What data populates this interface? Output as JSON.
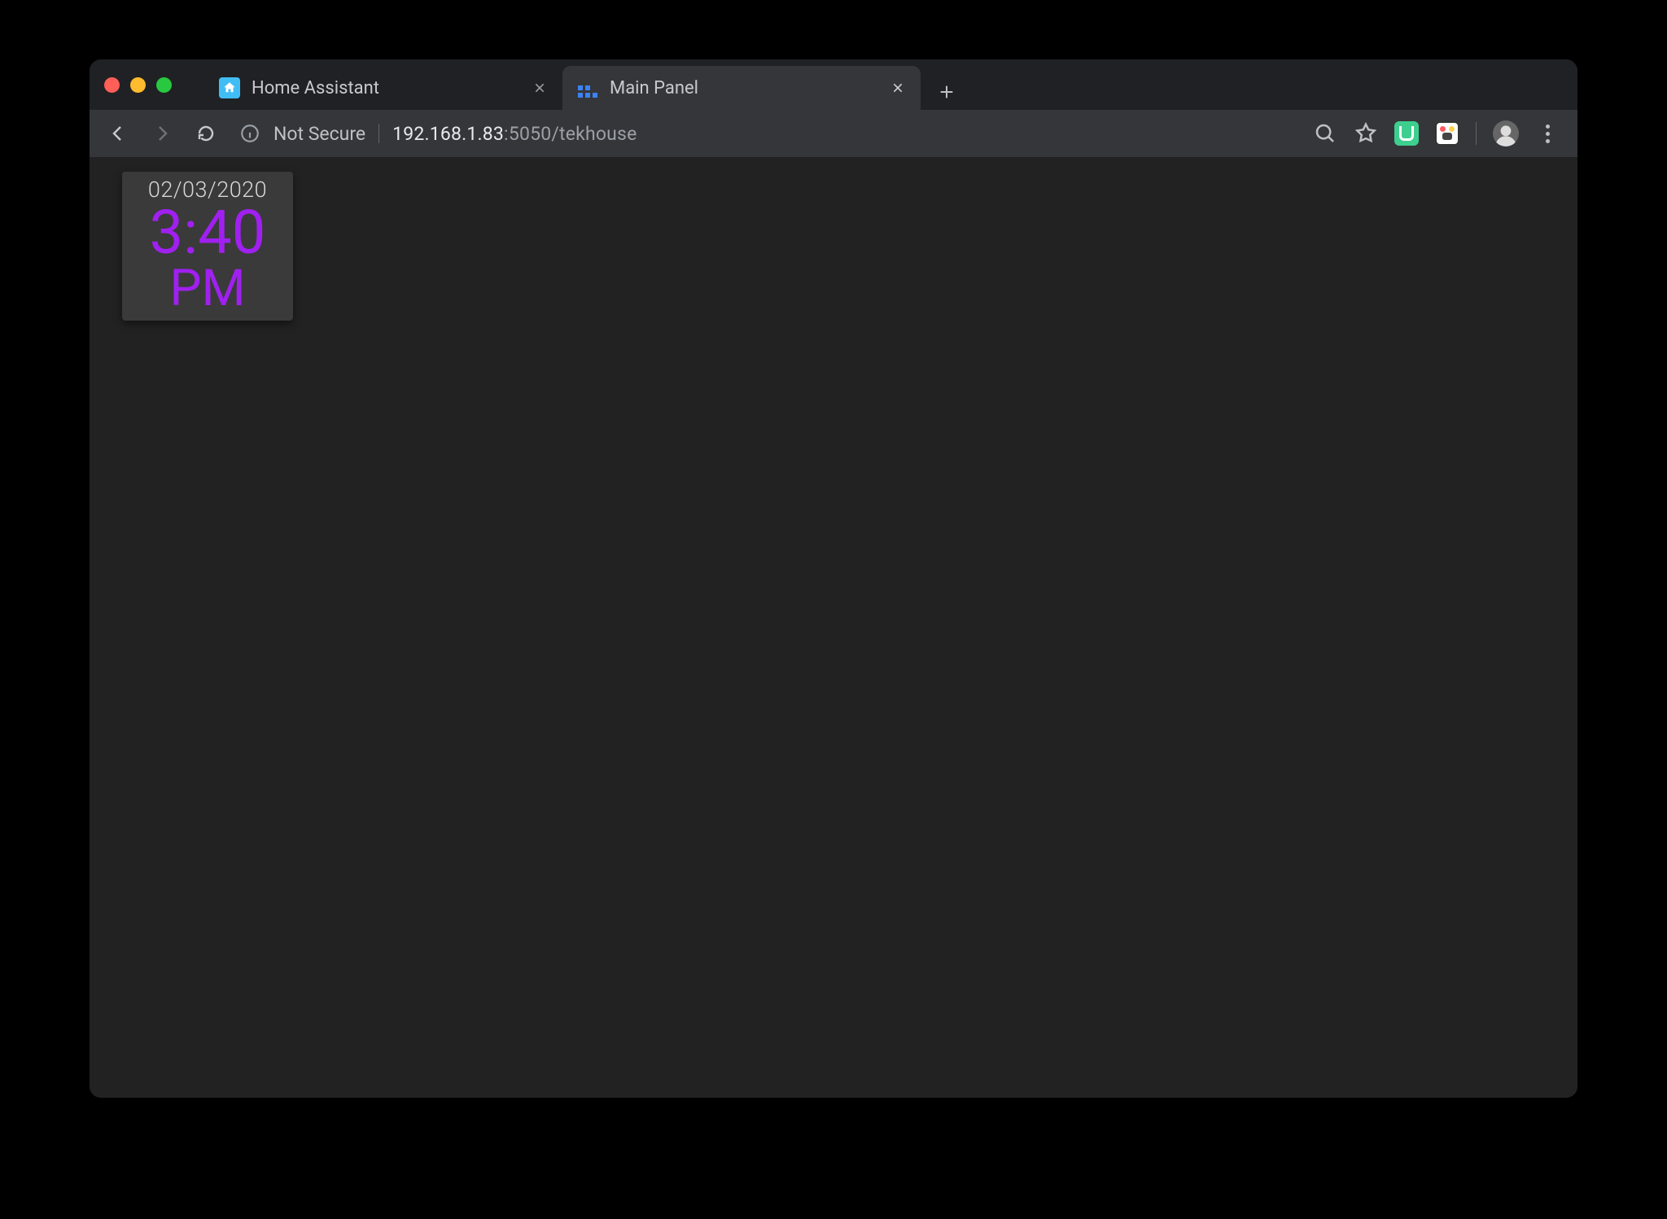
{
  "tabs": [
    {
      "label": "Home Assistant",
      "active": false
    },
    {
      "label": "Main Panel",
      "active": true
    }
  ],
  "addressbar": {
    "security_label": "Not Secure",
    "host": "192.168.1.83",
    "port_path": ":5050/tekhouse"
  },
  "content": {
    "clock": {
      "date": "02/03/2020",
      "time": "3:40",
      "ampm": "PM"
    }
  },
  "colors": {
    "clock_accent": "#a020f0",
    "card_bg": "#3a3a3a",
    "page_bg": "#222222"
  }
}
